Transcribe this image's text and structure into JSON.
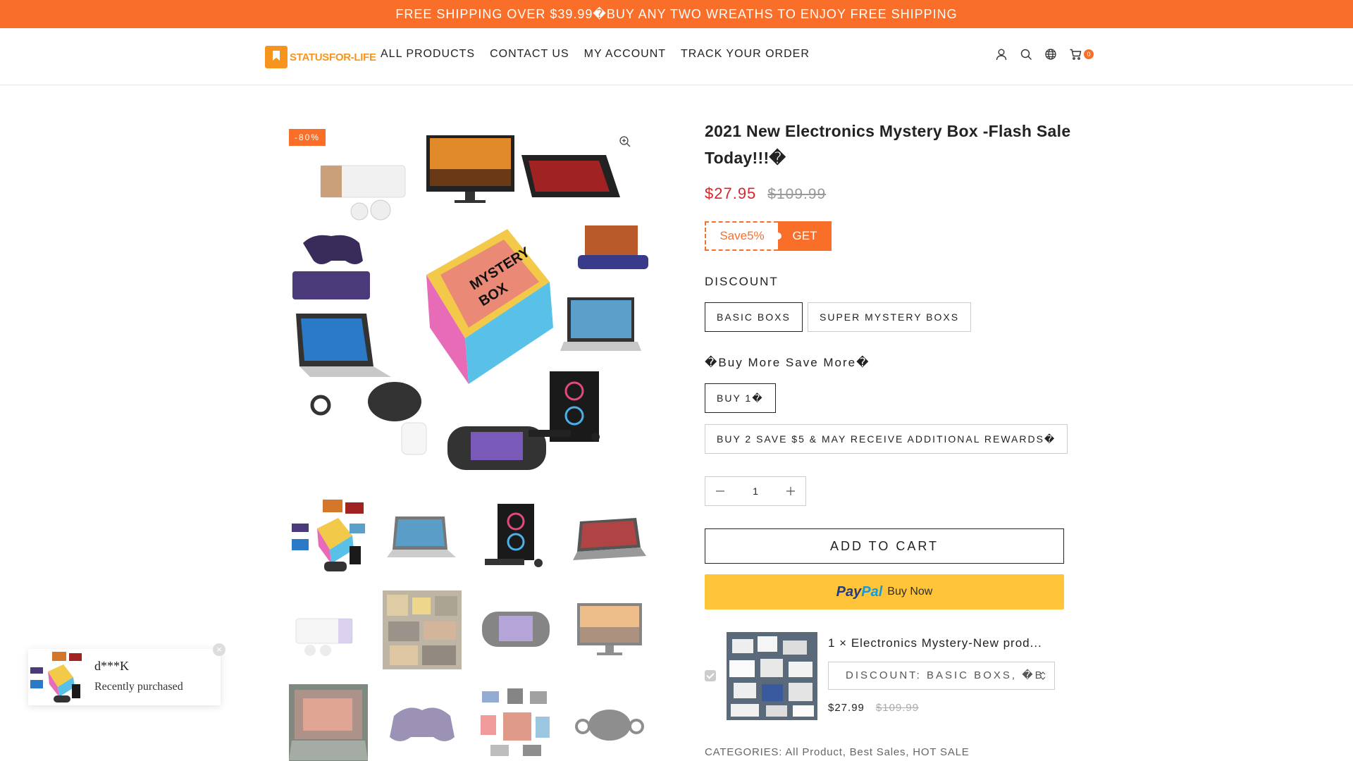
{
  "announcement": "FREE SHIPPING OVER $39.99�BUY ANY TWO WREATHS TO ENJOY FREE SHIPPING",
  "brand": {
    "logo_text": "STATUSFOR-LIFE",
    "color": "#f7941d"
  },
  "nav": [
    {
      "label": "ALL PRODUCTS"
    },
    {
      "label": "CONTACT US"
    },
    {
      "label": "MY ACCOUNT"
    },
    {
      "label": "TRACK YOUR ORDER"
    }
  ],
  "header_icons": [
    "user-icon",
    "search-icon",
    "globe-icon",
    "cart-icon"
  ],
  "cart": {
    "count": "0"
  },
  "gallery": {
    "badge": "-80%",
    "thumb_count": 12
  },
  "product": {
    "title": "2021 New Electronics Mystery Box -Flash Sale Today!!!�",
    "price": "$27.95",
    "compare_price": "$109.99",
    "coupon": {
      "label": "Save5%",
      "action": "GET"
    }
  },
  "options": {
    "discount": {
      "label": "DISCOUNT",
      "values": [
        "BASIC BOXS",
        "SUPER MYSTERY BOXS"
      ],
      "selected": "BASIC BOXS"
    },
    "bundle": {
      "label": "�Buy More Save More�",
      "values": [
        "BUY 1�",
        "BUY 2 SAVE $5 & MAY RECEIVE ADDITIONAL REWARDS�"
      ],
      "selected": "BUY 1�"
    }
  },
  "quantity": "1",
  "add_to_cart": "ADD TO CART",
  "paypal": {
    "logo_a": "Pay",
    "logo_b": "Pal",
    "text": "Buy Now"
  },
  "upsell": {
    "name": "1 × Electronics Mystery-New prod...",
    "variant": "DISCOUNT: BASIC BOXS, �B",
    "price": "$27.99",
    "compare_price": "$109.99"
  },
  "categories": {
    "label": "CATEGORIES:",
    "values": "All Product, Best Sales, HOT SALE"
  },
  "popup": {
    "name": "d***K",
    "text": "Recently purchased",
    "close": "×"
  },
  "colors": {
    "accent": "#f96f2a",
    "sale_price": "#d7262c",
    "paypal": "#ffc439"
  }
}
